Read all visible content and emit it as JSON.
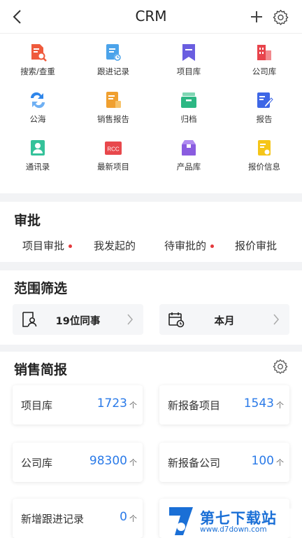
{
  "header": {
    "title": "CRM"
  },
  "menu": {
    "items": [
      {
        "label": "搜索/查重",
        "icon": "search-doc-icon",
        "color": "#ef5a3c"
      },
      {
        "label": "跟进记录",
        "icon": "follow-record-icon",
        "color": "#4ba3ea"
      },
      {
        "label": "项目库",
        "icon": "bookmark-icon",
        "color": "#6a5ee0"
      },
      {
        "label": "公司库",
        "icon": "building-icon",
        "color": "#e8444c"
      },
      {
        "label": "公海",
        "icon": "swap-icon",
        "color": "#2f86ea"
      },
      {
        "label": "销售报告",
        "icon": "sales-report-icon",
        "color": "#f0a030"
      },
      {
        "label": "归档",
        "icon": "archive-icon",
        "color": "#2cb783"
      },
      {
        "label": "报告",
        "icon": "report-icon",
        "color": "#3e67e6"
      },
      {
        "label": "通讯录",
        "icon": "contacts-icon",
        "color": "#35c29a"
      },
      {
        "label": "最新项目",
        "icon": "rcc-icon",
        "color": "#e8484c",
        "badge": "RCC"
      },
      {
        "label": "产品库",
        "icon": "product-box-icon",
        "color": "#8a5ce0"
      },
      {
        "label": "报价信息",
        "icon": "quote-icon",
        "color": "#f5c518"
      }
    ]
  },
  "approval": {
    "title": "审批",
    "tabs": [
      {
        "label": "项目审批",
        "dot": true
      },
      {
        "label": "我发起的",
        "dot": false
      },
      {
        "label": "待审批的",
        "dot": true
      },
      {
        "label": "报价审批",
        "dot": false
      }
    ]
  },
  "filter": {
    "title": "范围筛选",
    "colleagues": "19位同事",
    "period": "本月"
  },
  "sales": {
    "title": "销售简报",
    "unit": "个",
    "stats": [
      {
        "label": "项目库",
        "value": "1723"
      },
      {
        "label": "新报备项目",
        "value": "1543"
      },
      {
        "label": "公司库",
        "value": "98300"
      },
      {
        "label": "新报备公司",
        "value": "100"
      },
      {
        "label": "新增跟进记录",
        "value": "0"
      },
      {
        "label": "",
        "value": ""
      }
    ]
  },
  "watermark": {
    "title": "第七下载站",
    "url": "www.d7down.com"
  },
  "colors": {
    "accent": "#2a7ae8",
    "dot": "#e4393c"
  }
}
